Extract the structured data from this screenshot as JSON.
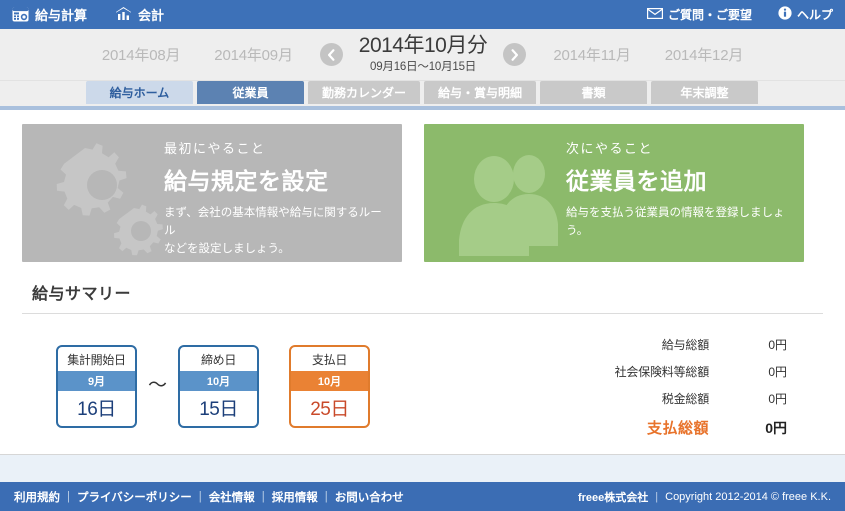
{
  "topbar": {
    "brand_payroll": "給与計算",
    "brand_accounting": "会計",
    "payroll_icon": "calendar-calculator-icon",
    "accounting_icon": "bar-chart-icon",
    "contact_label": "ご質問・ご要望",
    "contact_icon": "mail-icon",
    "help_label": "ヘルプ",
    "help_icon": "info-circle-icon",
    "background_color": "#3d71b8"
  },
  "month_nav": {
    "prev_months": [
      "2014年08月",
      "2014年09月"
    ],
    "next_months": [
      "2014年11月",
      "2014年12月"
    ],
    "prev_arrow_icon": "chevron-left-icon",
    "next_arrow_icon": "chevron-right-icon",
    "current_month": "2014年10月分",
    "current_range": "09月16日〜10月15日"
  },
  "tabs": [
    {
      "label": "給与ホーム",
      "state": "light"
    },
    {
      "label": "従業員",
      "state": "active"
    },
    {
      "label": "勤務カレンダー",
      "state": "gray"
    },
    {
      "label": "給与・賞与明細",
      "state": "gray"
    },
    {
      "label": "書類",
      "state": "gray"
    },
    {
      "label": "年末調整",
      "state": "gray"
    }
  ],
  "cards": [
    {
      "kicker": "最初にやること",
      "title": "給与規定を設定",
      "desc_line1": "まず、会社の基本情報や給与に関するルール",
      "desc_line2": "などを設定しましょう。",
      "icon": "gears-icon",
      "color": "#b7b7b7"
    },
    {
      "kicker": "次にやること",
      "title": "従業員を追加",
      "desc_line1": "給与を支払う従業員の情報を登録しましょう。",
      "desc_line2": "",
      "icon": "people-icon",
      "color": "#8cba6b"
    }
  ],
  "summary": {
    "title": "給与サマリー",
    "tilde": "〜",
    "date_boxes": [
      {
        "label": "集計開始日",
        "month": "9月",
        "day": "16日",
        "accent": "#2e6ca4"
      },
      {
        "label": "締め日",
        "month": "10月",
        "day": "15日",
        "accent": "#2e6ca4"
      },
      {
        "label": "支払日",
        "month": "10月",
        "day": "25日",
        "accent": "#e07b2c"
      }
    ],
    "amounts": [
      {
        "label": "給与総額",
        "value": "0円"
      },
      {
        "label": "社会保険料等総額",
        "value": "0円"
      },
      {
        "label": "税金総額",
        "value": "0円"
      }
    ],
    "total": {
      "label": "支払総額",
      "value": "0円",
      "color": "#e8732b"
    }
  },
  "footer": {
    "links": [
      "利用規約",
      "プライバシーポリシー",
      "会社情報",
      "採用情報",
      "お問い合わせ"
    ],
    "separator": "|",
    "company": "freee株式会社",
    "copyright": "Copyright 2012-2014 © freee K.K.",
    "background_color": "#3b6db4"
  }
}
